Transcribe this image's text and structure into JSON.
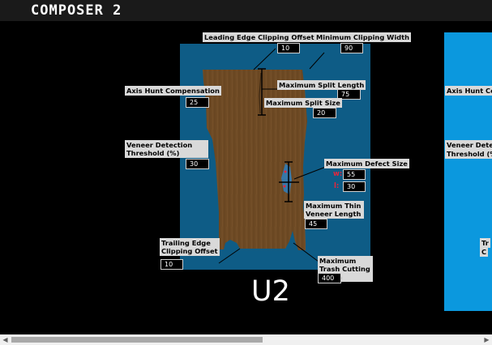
{
  "app": {
    "title": "COMPOSER 2"
  },
  "unit_label": "U2",
  "labels": {
    "leading_edge": "Leading Edge Clipping Offset",
    "min_clip_width": "Minimum Clipping Width",
    "axis_hunt": "Axis Hunt Compensation",
    "max_split_length": "Maximum Split Length",
    "max_split_size": "Maximum Split Size",
    "veneer_detection": "Veneer Detection Threshold (%)",
    "max_defect": "Maximum Defect Size",
    "max_thin": "Maximum Thin Veneer Length",
    "trailing_edge": "Trailing Edge Clipping Offset",
    "max_trash": "Maximum Trash Cutting Width"
  },
  "values": {
    "leading_edge": "10",
    "min_clip_width": "90",
    "axis_hunt": "25",
    "max_split_length": "75",
    "max_split_size": "20",
    "veneer_detection": "30",
    "defect_w": "55",
    "defect_l": "30",
    "max_thin": "45",
    "trailing_edge": "10",
    "max_trash": "400"
  },
  "defect_dims": {
    "w": "w:",
    "l": "l:"
  },
  "side_panel": {
    "axis_hunt": "Axis Hunt Co",
    "veneer_line1": "Veneer Dete",
    "veneer_line2": "Threshold (%",
    "trailing_line1": "Tr",
    "trailing_line2": "C"
  },
  "colors": {
    "background": "#000000",
    "stage": "#0e5c86",
    "veneer": "#6e4a24",
    "side_panel": "#0b98de",
    "accent_red": "#e8253c"
  }
}
